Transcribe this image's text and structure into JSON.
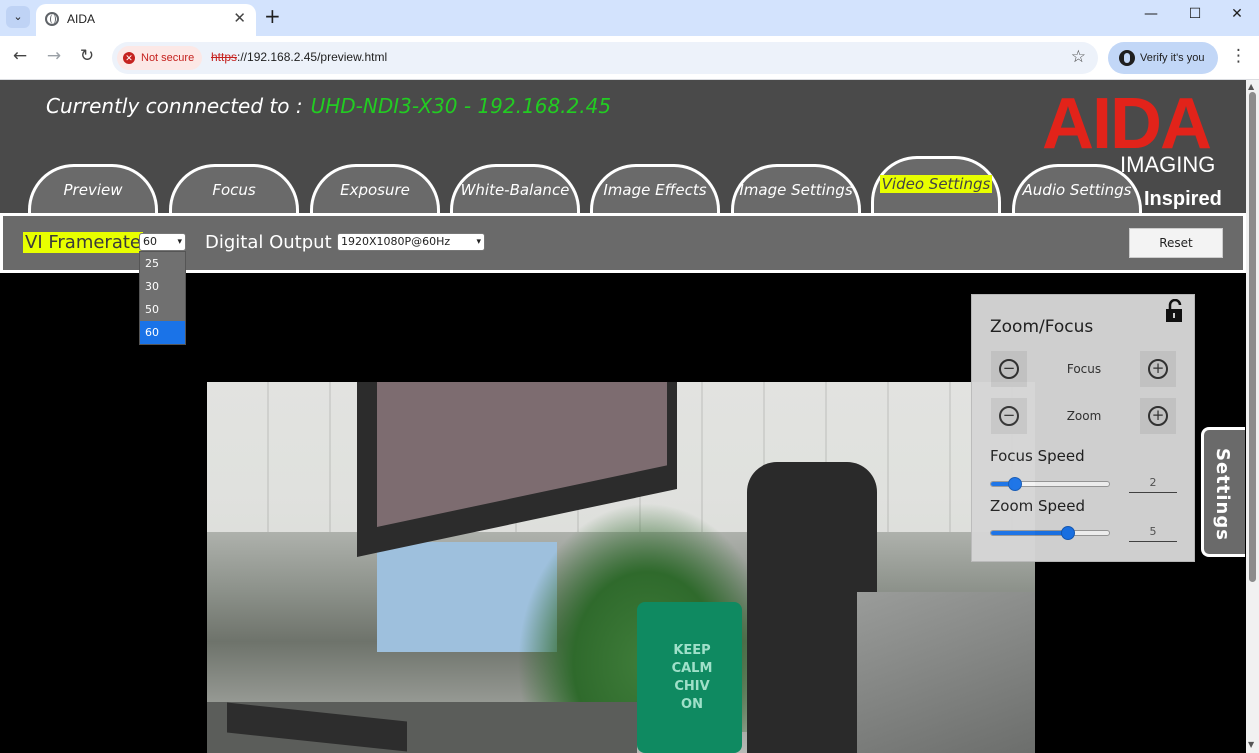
{
  "browser": {
    "tab_title": "AIDA",
    "url_scheme": "https",
    "url_rest": "://192.168.2.45/preview.html",
    "security_chip": "Not secure",
    "verify_label": "Verify it's you"
  },
  "header": {
    "connected_label": "Currently connnected to :",
    "device": "UHD-NDI3-X30 - 192.168.2.45",
    "logo_main": "AIDA",
    "logo_sub": "IMAGING",
    "logo_tag": "Inspired"
  },
  "tabs": [
    {
      "label": "Preview"
    },
    {
      "label": "Focus"
    },
    {
      "label": "Exposure"
    },
    {
      "label": "White-Balance"
    },
    {
      "label": "Image Effects"
    },
    {
      "label": "Image Settings"
    },
    {
      "label": "Video Settings",
      "active": true
    },
    {
      "label": "Audio Settings"
    }
  ],
  "video_settings": {
    "framerate_label": "VI Framerate",
    "framerate_value": "60",
    "framerate_options": [
      "25",
      "30",
      "50",
      "60"
    ],
    "digital_output_label": "Digital Output",
    "digital_output_value": "1920X1080P@60Hz",
    "reset_label": "Reset"
  },
  "preview_image": {
    "mug_text": [
      "KEEP",
      "CALM",
      "CHIV",
      "ON"
    ]
  },
  "zoom_focus": {
    "title": "Zoom/Focus",
    "focus_label": "Focus",
    "zoom_label": "Zoom",
    "focus_speed_label": "Focus Speed",
    "focus_speed_value": "2",
    "focus_speed_fraction": 0.2,
    "zoom_speed_label": "Zoom Speed",
    "zoom_speed_value": "5",
    "zoom_speed_fraction": 0.65
  },
  "side_tab_label": "Settings",
  "colors": {
    "brand_red": "#e2231a",
    "connected_green": "#22cc22",
    "highlight_yellow": "#e8ff00",
    "selection_blue": "#1a73e8"
  }
}
